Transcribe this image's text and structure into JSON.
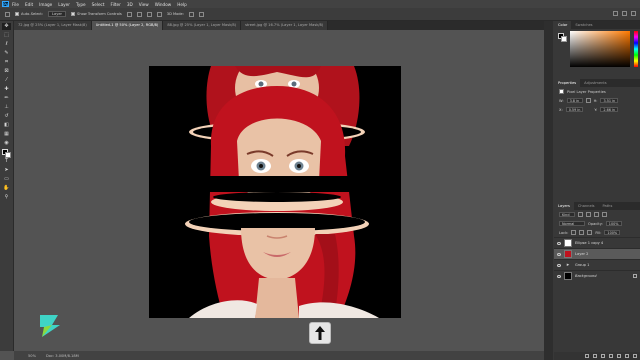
{
  "app": {
    "logo": "Ps"
  },
  "menu": [
    "File",
    "Edit",
    "Image",
    "Layer",
    "Type",
    "Select",
    "Filter",
    "3D",
    "View",
    "Window",
    "Help"
  ],
  "options": {
    "auto_select_label": "Auto-Select:",
    "auto_select_value": "Layer",
    "show_transform_label": "Show Transform Controls",
    "mode_label": "3D Mode:"
  },
  "tabs": [
    "72.jpg @ 25% (Layer 1, Layer Mask/8)",
    "Untitled-1 @ 50% (Layer 2, RGB/8)",
    "88.jpg @ 25% (Layer 1, Layer Mask/8)",
    "street.jpg @ 16.7% (Layer 1, Layer Mask/8)"
  ],
  "status": {
    "zoom": "50%",
    "doc": "Doc: 3.00M/8.18M"
  },
  "color_panel": {
    "tabs": [
      "Color",
      "Swatches"
    ]
  },
  "properties_panel": {
    "tabs": [
      "Properties",
      "Adjustments"
    ],
    "title": "Pixel Layer Properties",
    "w_label": "W:",
    "w_value": "3.8 in",
    "h_label": "H:",
    "h_value": "3.51 in",
    "x_label": "X:",
    "x_value": "0.59 in",
    "y_label": "Y:",
    "y_value": "2.66 in"
  },
  "layers_panel": {
    "tabs": [
      "Layers",
      "Channels",
      "Paths"
    ],
    "kind_label": "Kind",
    "blend_mode": "Normal",
    "opacity_label": "Opacity:",
    "opacity_value": "100%",
    "lock_label": "Lock:",
    "fill_label": "Fill:",
    "fill_value": "100%",
    "layers": [
      {
        "name": "Ellipse 1 copy 4",
        "selected": false
      },
      {
        "name": "Layer 2",
        "selected": true
      },
      {
        "name": "Group 1",
        "selected": false
      },
      {
        "name": "Background",
        "selected": false
      }
    ]
  },
  "colors": {
    "hair": "#c0121e",
    "skin": "#e9c2a6",
    "accent": "#31a8ff",
    "ring": "#f3d2b8"
  }
}
